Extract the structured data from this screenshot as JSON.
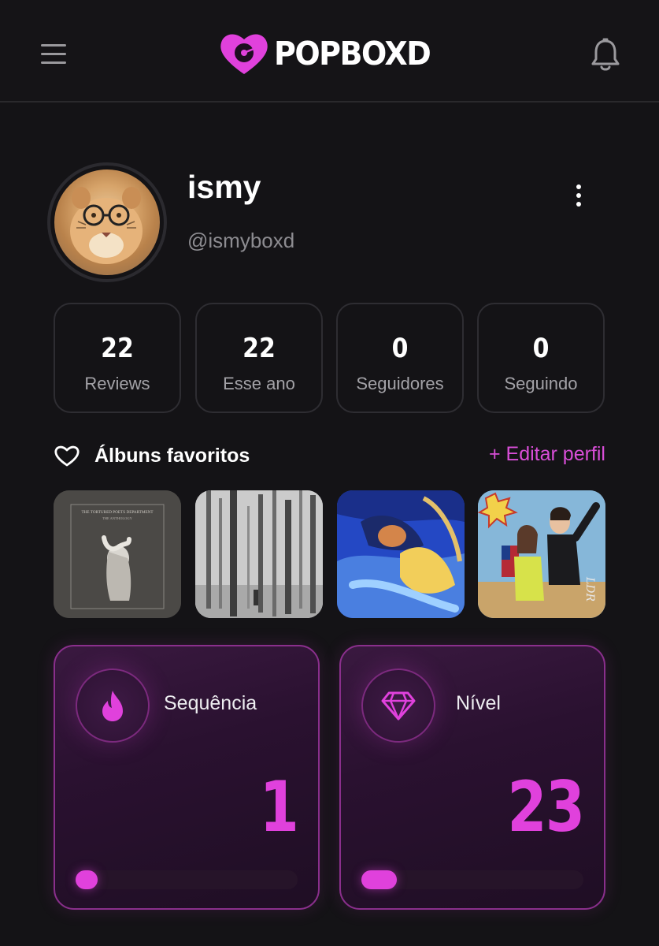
{
  "header": {
    "brand": "POPBOXD",
    "icons": {
      "menu": "hamburger-menu-icon",
      "logo": "heart-vinyl-logo-icon",
      "notifications": "bell-icon"
    }
  },
  "profile": {
    "name": "ismy",
    "handle": "@ismyboxd",
    "avatar_description_icon": "avatar-tiger-with-glasses",
    "more_icon": "vertical-dots-icon"
  },
  "stats": [
    {
      "value": "22",
      "label": "Reviews"
    },
    {
      "value": "22",
      "label": "Esse ano"
    },
    {
      "value": "0",
      "label": "Seguidores"
    },
    {
      "value": "0",
      "label": "Seguindo"
    }
  ],
  "favorites": {
    "title": "Álbuns favoritos",
    "edit_label": "+ Editar perfil",
    "icon": "heart-outline-icon",
    "albums": [
      {
        "cover_text": "THE TORTURED POETS DEPARTMENT",
        "cover_subtext": "THE ANTHOLOGY"
      },
      {
        "cover_text": ""
      },
      {
        "cover_text": ""
      },
      {
        "cover_text": "LDR"
      }
    ]
  },
  "cards": [
    {
      "title": "Sequência",
      "value": "1",
      "icon": "flame-icon",
      "progress": 0.1
    },
    {
      "title": "Nível",
      "value": "23",
      "icon": "diamond-icon",
      "progress": 0.16
    }
  ],
  "colors": {
    "accent": "#e041dc",
    "background": "#141316",
    "card_border": "#8a2f8c",
    "muted_text": "#8d8c91"
  }
}
